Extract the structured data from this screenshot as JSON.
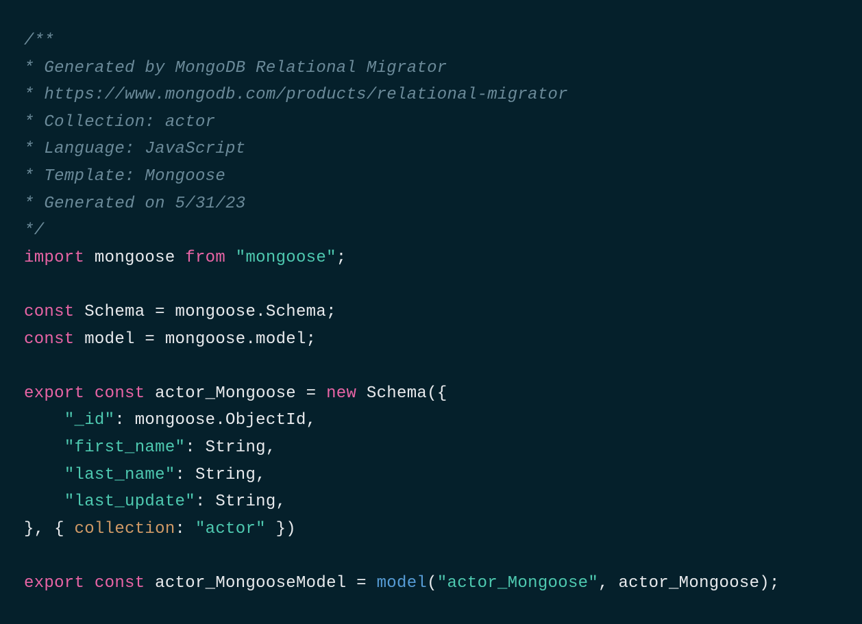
{
  "code": {
    "comment_lines": [
      "/**",
      "* Generated by MongoDB Relational Migrator",
      "* https://www.mongodb.com/products/relational-migrator",
      "* Collection: actor",
      "* Language: JavaScript",
      "* Template: Mongoose",
      "* Generated on 5/31/23",
      "*/"
    ],
    "import_keyword": "import",
    "import_name": "mongoose",
    "from_keyword": "from",
    "import_module": "\"mongoose\"",
    "semicolon": ";",
    "const_keyword": "const",
    "schema_var": "Schema = mongoose.Schema;",
    "model_var": "model = mongoose.model;",
    "export_keyword": "export",
    "actor_mongoose_name": "actor_Mongoose = ",
    "new_keyword": "new",
    "schema_call": " Schema({",
    "field_id": "\"_id\"",
    "field_id_type": ": mongoose.ObjectId,",
    "field_first_name": "\"first_name\"",
    "field_first_name_type": ": String,",
    "field_last_name": "\"last_name\"",
    "field_last_name_type": ": String,",
    "field_last_update": "\"last_update\"",
    "field_last_update_type": ": String,",
    "close_brace": "}, { ",
    "collection_prop": "collection",
    "collection_value_prefix": ": ",
    "collection_value": "\"actor\"",
    "close_paren": " })",
    "model_var_name": "actor_MongooseModel = ",
    "model_func": "model",
    "model_arg1": "\"actor_Mongoose\"",
    "model_arg2": ", actor_Mongoose);",
    "open_paren": "("
  }
}
